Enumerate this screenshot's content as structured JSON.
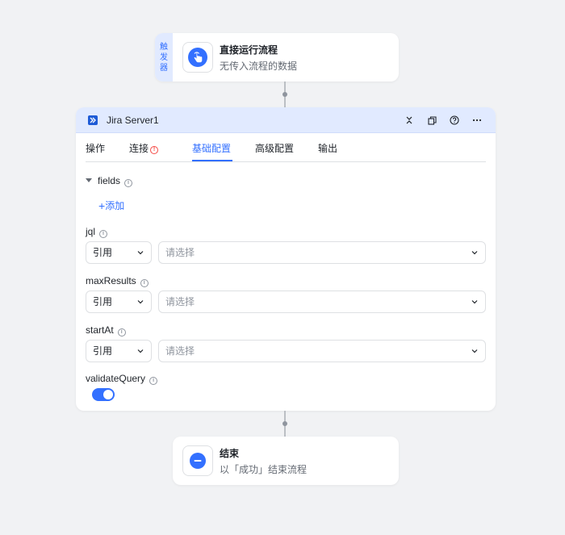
{
  "trigger": {
    "tag_chars": [
      "触",
      "发",
      "器"
    ],
    "title": "直接运行流程",
    "subtitle": "无传入流程的数据",
    "icon": "tap-hand-icon"
  },
  "main": {
    "title": "Jira Server1",
    "app_icon": "jira-icon",
    "header_actions": [
      "collapse-icon",
      "copy-icon",
      "help-icon",
      "more-icon"
    ],
    "tabs": [
      {
        "label": "操作",
        "active": false
      },
      {
        "label": "连接",
        "active": false,
        "warning": true
      },
      {
        "label": "基础配置",
        "active": true
      },
      {
        "label": "高级配置",
        "active": false
      },
      {
        "label": "输出",
        "active": false
      }
    ],
    "fields_group": {
      "label": "fields",
      "add_label": "添加"
    },
    "params": [
      {
        "label": "jql",
        "mode": "引用",
        "placeholder": "请选择"
      },
      {
        "label": "maxResults",
        "mode": "引用",
        "placeholder": "请选择"
      },
      {
        "label": "startAt",
        "mode": "引用",
        "placeholder": "请选择"
      }
    ],
    "validate_query": {
      "label": "validateQuery",
      "enabled": true
    }
  },
  "end": {
    "title": "结束",
    "subtitle": "以「成功」结束流程",
    "icon": "minus-circle-icon"
  },
  "colors": {
    "accent": "#3370ff",
    "header_bg": "#e1eaff",
    "warning": "#f54a45",
    "canvas": "#f1f2f4"
  }
}
